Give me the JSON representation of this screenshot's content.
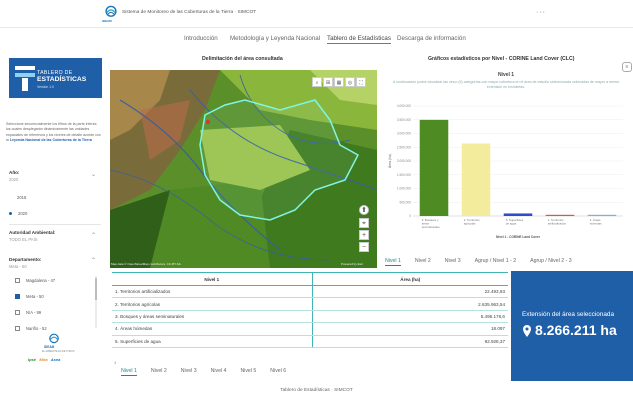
{
  "header": {
    "logo_text": "IDEAM",
    "site_title": "Sistema de Monitoreo de las Coberturas de la Tierra · SIMCOT",
    "menu": "···"
  },
  "nav": {
    "tabs": [
      "Introducción",
      "Metodología y Leyenda Nacional",
      "Tablero de Estadísticas",
      "Descarga de información"
    ],
    "active": "Tablero de Estadísticas"
  },
  "brand": {
    "line1": "TABLERO DE",
    "line2": "ESTADÍSTICAS",
    "version": "Versión 1.0"
  },
  "sidebar": {
    "intro_text": "Seleccione secuencialmente los filtros de la parte inferior, los cuales desplegarán dinámicamente las unidades espaciales de referencia y los niveles de detalle acorde con la",
    "intro_link": "Leyenda Nacional de las Coberturas de la Tierra",
    "year_label": "Año:",
    "year_value": "2020",
    "years": [
      "2018",
      "2020"
    ],
    "selected_year": "2020",
    "authority_label": "Autoridad Ambiental:",
    "authority_value": "TODO EL PAÍS",
    "dept_label": "Departamento:",
    "dept_value": "Meta - 50",
    "departments": [
      {
        "label": "Magdalena - 47",
        "checked": false
      },
      {
        "label": "Meta - 50",
        "checked": true
      },
      {
        "label": "N/A - 99",
        "checked": false
      },
      {
        "label": "Nariño - 52",
        "checked": false
      }
    ],
    "dept_more": "3",
    "logo_text": "IDEAM",
    "logo_sub": "EL AMBIENTE ES DE TODOS",
    "partners": [
      "Ipsé",
      "Mira",
      "Asea"
    ]
  },
  "map": {
    "title": "Delimitación del área consultada",
    "attribution": "Map data © OpenStreetMap contributors, CC-BY-SA",
    "powered": "Powered by Esri",
    "tool_icons": [
      "search-icon",
      "layers-icon",
      "grid-icon",
      "target-icon",
      "expand-icon"
    ]
  },
  "chart": {
    "title": "Gráficos estadísticos por Nivel - CORINE Land Cover (CLC)",
    "subtitle": "Nivel 1",
    "description": "A continuación podrá visualizar las cinco (5) categorías con mayor cobertura en el área de estudio seleccionada ordenadas de mayor a menor extensión en hectáreas.",
    "menu_icon": "≡"
  },
  "chart_data": {
    "type": "bar",
    "title": "Nivel 1",
    "xlabel": "Nivel 1 - CORINE Land Cover",
    "ylabel": "Área (ha)",
    "ylim": [
      0,
      4000000
    ],
    "yticks": [
      "0",
      "500.000",
      "1.000.000",
      "1.500.000",
      "2.000.000",
      "2.500.000",
      "3.000.000",
      "3.500.000",
      "4.000.000"
    ],
    "categories": [
      "3. Bosques y áreas seminaturales",
      "2. Territorios agrícolas",
      "5. Superficies de agua",
      "1. Territorios artificializados",
      "4. Áreas húmedas"
    ],
    "values": [
      3496176,
      2635963,
      92928,
      22493,
      18097
    ],
    "colors": [
      "#4e8b22",
      "#f3ec9c",
      "#2c4fc9",
      "#e05252",
      "#74b4e8"
    ]
  },
  "level_tabs": {
    "upper": [
      "Nivel 1",
      "Nivel 2",
      "Nivel 3",
      "Agrup / Nivel 1 - 2",
      "Agrup / Nivel 2 - 3"
    ],
    "lower": [
      "Nivel 1",
      "Nivel 2",
      "Nivel 3",
      "Nivel 4",
      "Nivel 5",
      "Nivel 6"
    ],
    "active": "Nivel 1"
  },
  "table": {
    "headers": [
      "Nivel 1",
      "Área (ha)"
    ],
    "rows": [
      [
        "1. Territorios artificializados",
        "22.493,93"
      ],
      [
        "2. Territorios agrícolas",
        "2.635.963,54"
      ],
      [
        "3. Bosques y áreas seminaturales",
        "5.496.176,6"
      ],
      [
        "4. Áreas húmedas",
        "18.097"
      ],
      [
        "5. Superficies de agua",
        "92.928,37"
      ]
    ]
  },
  "extension": {
    "label": "Extensión del área seleccionada",
    "value": "8.266.211 ha"
  },
  "footer": "Tablero de Estadísticas · SIMCOT"
}
